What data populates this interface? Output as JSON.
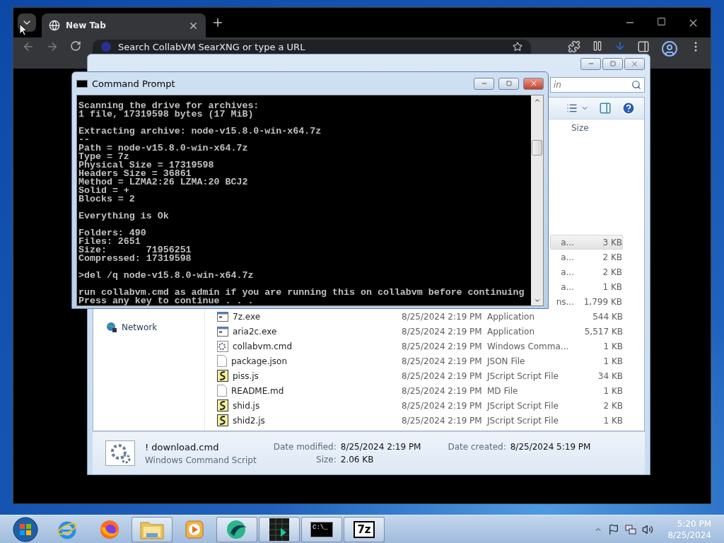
{
  "browser": {
    "tabs": [
      {
        "label": "New Tab",
        "selected": true
      }
    ],
    "address": {
      "placeholder": "Search CollabVM SearXNG or type a URL"
    }
  },
  "explorer": {
    "search": {
      "placeholder": "in"
    },
    "columns": [
      "Size"
    ],
    "sidebar": [
      {
        "label": "Network"
      }
    ],
    "rows": [
      {
        "type": "a...",
        "size": "3 KB",
        "kind": "covered",
        "selected": true
      },
      {
        "type": "a...",
        "size": "2 KB",
        "kind": "covered",
        "selected": false
      },
      {
        "type": "a...",
        "size": "2 KB",
        "kind": "covered",
        "selected": false
      },
      {
        "type": "a...",
        "size": "1 KB",
        "kind": "covered",
        "selected": false
      },
      {
        "type": "ns...",
        "size": "1,799 KB",
        "kind": "covered",
        "selected": false
      },
      {
        "name": "7z.exe",
        "date": "8/25/2024 2:19 PM",
        "type": "Application",
        "size": "544 KB",
        "kind": "exe",
        "selected": false
      },
      {
        "name": "aria2c.exe",
        "date": "8/25/2024 2:19 PM",
        "type": "Application",
        "size": "5,517 KB",
        "kind": "exe",
        "selected": false
      },
      {
        "name": "collabvm.cmd",
        "date": "8/25/2024 2:19 PM",
        "type": "Windows Comma...",
        "size": "1 KB",
        "kind": "cmd",
        "selected": false
      },
      {
        "name": "package.json",
        "date": "8/25/2024 2:19 PM",
        "type": "JSON File",
        "size": "1 KB",
        "kind": "file",
        "selected": false
      },
      {
        "name": "piss.js",
        "date": "8/25/2024 2:19 PM",
        "type": "JScript Script File",
        "size": "34 KB",
        "kind": "script",
        "selected": false
      },
      {
        "name": "README.md",
        "date": "8/25/2024 2:19 PM",
        "type": "MD File",
        "size": "1 KB",
        "kind": "file",
        "selected": false
      },
      {
        "name": "shid.js",
        "date": "8/25/2024 2:19 PM",
        "type": "JScript Script File",
        "size": "2 KB",
        "kind": "script",
        "selected": false
      },
      {
        "name": "shid2.js",
        "date": "8/25/2024 2:19 PM",
        "type": "JScript Script File",
        "size": "1 KB",
        "kind": "script",
        "selected": false
      }
    ],
    "details": {
      "name": "! download.cmd",
      "type": "Windows Command Script",
      "fields": [
        {
          "label": "Date modified:",
          "value": "8/25/2024 2:19 PM"
        },
        {
          "label": "Date created:",
          "value": "8/25/2024 5:19 PM"
        },
        {
          "label": "Size:",
          "value": "2.06 KB"
        }
      ]
    }
  },
  "cmd": {
    "title": "Command Prompt",
    "blocks": [
      [
        "Scanning the drive for archives:",
        "1 file, 17319598 bytes (17 MiB)"
      ],
      [
        "Extracting archive: node-v15.8.0-win-x64.7z",
        "--",
        "Path = node-v15.8.0-win-x64.7z",
        "Type = 7z",
        "Physical Size = 17319598",
        "Headers Size = 36861",
        "Method = LZMA2:26 LZMA:20 BCJ2",
        "Solid = +",
        "Blocks = 2"
      ],
      [
        "Everything is Ok"
      ],
      [
        "Folders: 490",
        "Files: 2651",
        "Size:       71956251",
        "Compressed: 17319598"
      ],
      [
        ">del /q node-v15.8.0-win-x64.7z"
      ],
      [
        "run collabvm.cmd as admin if you are running this on collabvm before continuing",
        "Press any key to continue . . ."
      ]
    ]
  },
  "taskbar": {
    "apps": [
      {
        "kind": "ie",
        "running": false
      },
      {
        "kind": "firefox",
        "running": false
      },
      {
        "kind": "folder",
        "running": true
      },
      {
        "kind": "media",
        "running": false
      },
      {
        "kind": "orb",
        "running": true
      },
      {
        "kind": "grid",
        "running": true
      },
      {
        "kind": "cmd",
        "running": true,
        "label": "C:\\_"
      },
      {
        "kind": "sevenzip",
        "running": true,
        "label": "7z"
      }
    ],
    "time": "5:20 PM",
    "date": "8/25/2024"
  }
}
